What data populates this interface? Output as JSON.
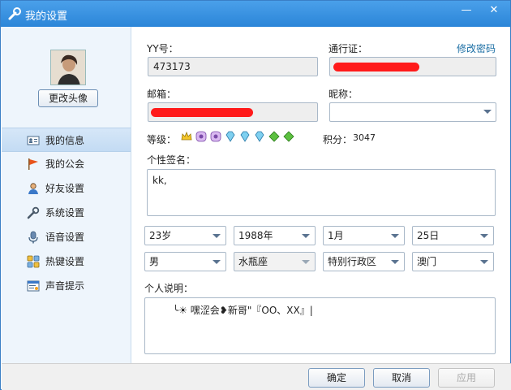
{
  "window": {
    "title": "我的设置",
    "minimize_glyph": "—",
    "close_glyph": "✕"
  },
  "sidebar": {
    "change_avatar": "更改头像",
    "items": [
      {
        "label": "我的信息",
        "icon": "id-card-icon",
        "active": true
      },
      {
        "label": "我的公会",
        "icon": "flag-icon"
      },
      {
        "label": "好友设置",
        "icon": "friend-icon"
      },
      {
        "label": "系统设置",
        "icon": "wrench-icon"
      },
      {
        "label": "语音设置",
        "icon": "microphone-icon"
      },
      {
        "label": "热键设置",
        "icon": "hotkey-icon"
      },
      {
        "label": "声音提示",
        "icon": "sound-icon"
      }
    ]
  },
  "main": {
    "yy_label": "YY号：",
    "yy_value": "473173",
    "passport_label": "通行证：",
    "change_password": "修改密码",
    "email_label": "邮箱：",
    "nickname_label": "昵称：",
    "nickname_value": "",
    "level_label": "等级：",
    "points_label": "积分：",
    "points_value": "3047",
    "signature_label": "个性签名：",
    "signature_value": "kk,",
    "age": "23岁",
    "birth_year": "1988年",
    "birth_month": "1月",
    "birth_day": "25日",
    "gender": "男",
    "zodiac": "水瓶座",
    "region": "特别行政区",
    "city": "澳门",
    "about_label": "个人说明：",
    "about_value": "╰☀ 嘿涩会❥新哥\"『ОО、ХХ』|"
  },
  "footer": {
    "ok": "确定",
    "cancel": "取消",
    "apply": "应用"
  },
  "colors": {
    "titlebar": "#2b85d8",
    "redaction": "#ff1a1a",
    "link": "#1c6fa5"
  }
}
